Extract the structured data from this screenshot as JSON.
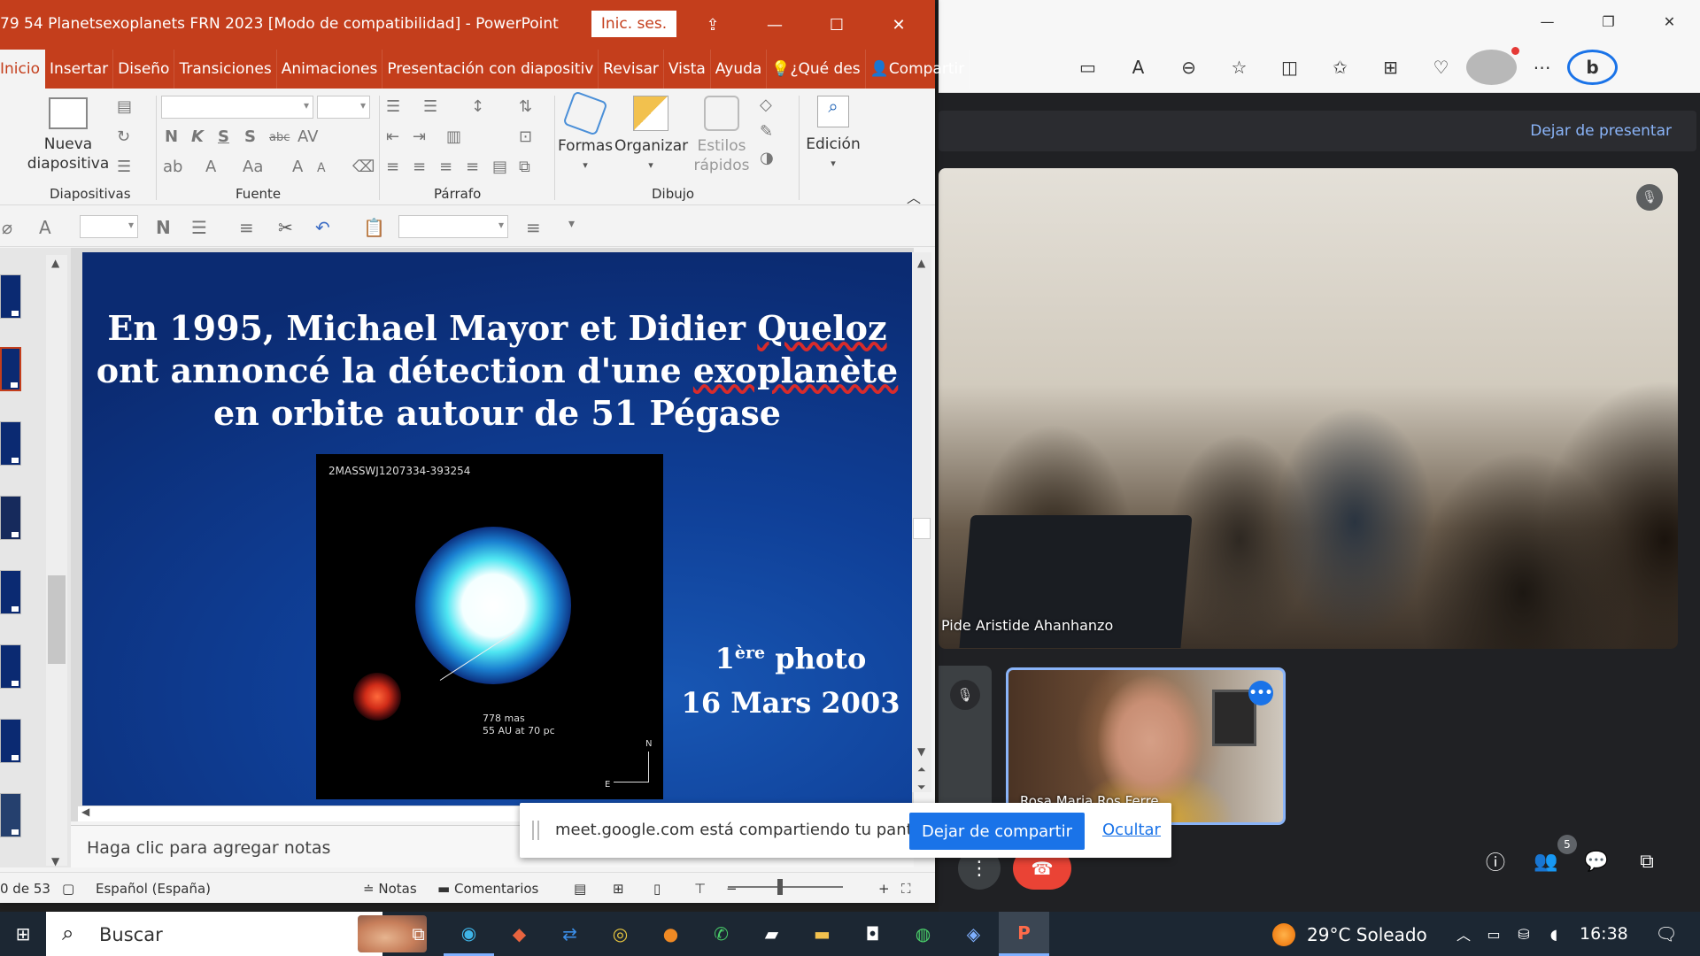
{
  "ppt": {
    "title": "79 54 Planetsexoplanets FRN 2023 [Modo de compatibilidad]  -  PowerPoint",
    "signin": "Inic. ses.",
    "tabs": [
      "Inicio",
      "Insertar",
      "Diseño",
      "Transiciones",
      "Animaciones",
      "Presentación con diapositiv",
      "Revisar",
      "Vista",
      "Ayuda",
      "¿Qué des",
      "Compartir"
    ],
    "ribbon": {
      "new_slide_line1": "Nueva",
      "new_slide_line2": "diapositiva",
      "shapes": "Formas",
      "arrange": "Organizar",
      "quick_styles_line1": "Estilos",
      "quick_styles_line2": "rápidos",
      "editing": "Edición",
      "groups": {
        "slides": "Diapositivas",
        "font": "Fuente",
        "paragraph": "Párrafo",
        "drawing": "Dibujo"
      },
      "bold": "N",
      "italic": "K",
      "underline": "S",
      "strike": "S",
      "abc": "abc"
    },
    "slide": {
      "title_part1": "En 1995, Michael Mayor et Didier ",
      "title_word1": "Queloz",
      "title_part2": " ont annoncé la détection d'une ",
      "title_word2": "exoplanète",
      "title_part3": " en orbite autour de 51 Pégase",
      "image_label": "2MASSWJ1207334-393254",
      "scale_line1": "778 mas",
      "scale_line2": "55 AU at 70 pc",
      "compass_n": "N",
      "compass_e": "E",
      "caption_num": "1",
      "caption_sup": "ère",
      "caption_word": " photo",
      "caption_date": "16 Mars 2003"
    },
    "notes_placeholder": "Haga clic para agregar notas",
    "status": {
      "slide_count": "0 de 53",
      "language": "Español (España)",
      "notes": "Notas",
      "comments": "Comentarios"
    }
  },
  "meet": {
    "stop_presenting": "Dejar de presentar",
    "main_participant": "Pide Aristide Ahanhanzo",
    "self_participant": "Rosa Maria Ros Ferre",
    "participant_count": "5"
  },
  "share_bar": {
    "message": "meet.google.com está compartiendo tu pantalla.",
    "stop_button": "Dejar de compartir",
    "hide_link": "Ocultar"
  },
  "taskbar": {
    "search": "Buscar",
    "weather": "29°C  Soleado",
    "time": "16:38"
  },
  "colors": {
    "ppt_accent": "#c43e1c",
    "meet_blue": "#1a73e8",
    "leave_red": "#ea4335"
  }
}
